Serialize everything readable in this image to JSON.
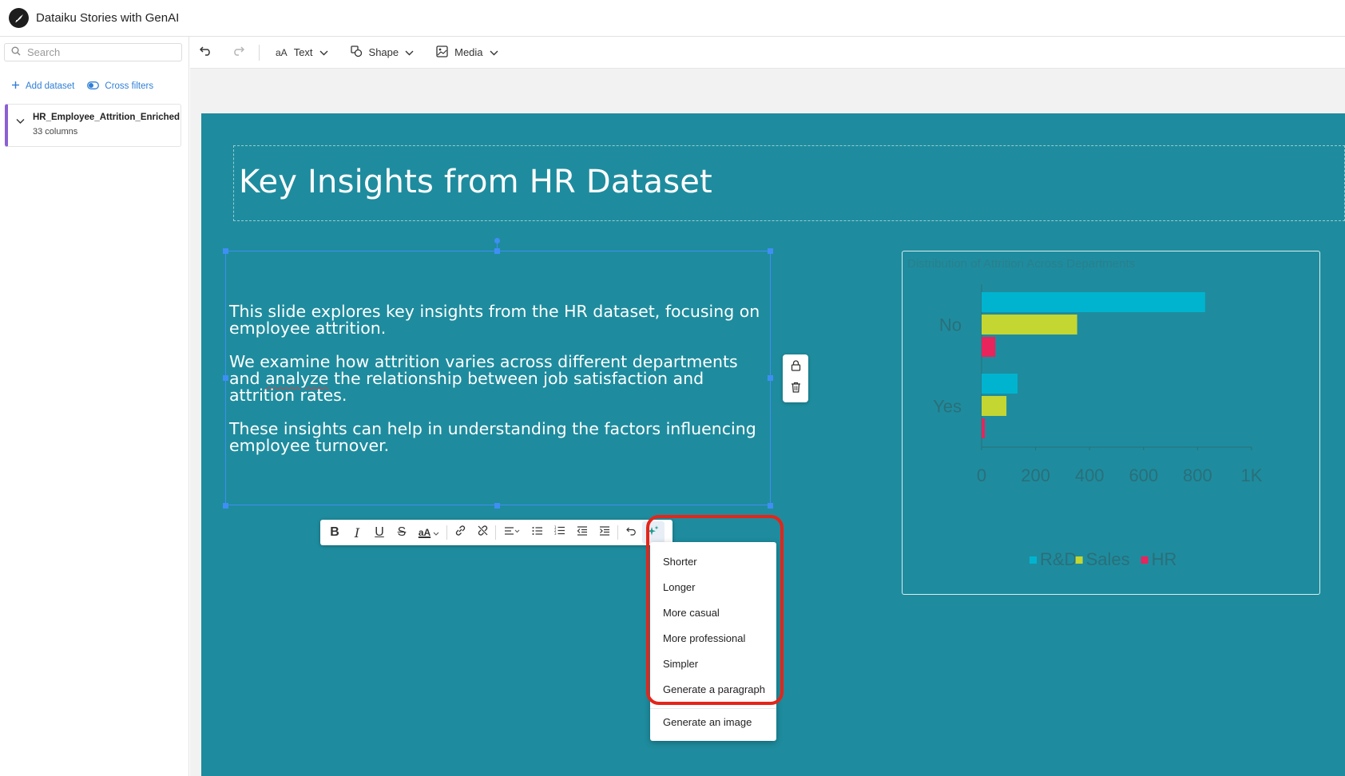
{
  "app": {
    "title": "Dataiku Stories with GenAI"
  },
  "sidebar": {
    "search_placeholder": "Search",
    "add_dataset": "Add dataset",
    "cross_filters": "Cross filters",
    "dataset": {
      "name": "HR_Employee_Attrition_Enriched",
      "columns": "33 columns",
      "accent": "#8c5fd4"
    }
  },
  "toolbar": {
    "undo_icon": "undo-icon",
    "redo_icon": "redo-icon",
    "text_glyph": "aA",
    "text_label": "Text",
    "shape_label": "Shape",
    "media_label": "Media"
  },
  "slide": {
    "background": "#1e8c9e",
    "title": "Key Insights from HR Dataset",
    "paragraphs": {
      "p1": "This slide explores key insights from the HR dataset, focusing on employee attrition.",
      "p2_a": "We examine how attrition varies across different departments and ",
      "p2_b": "analyze",
      "p2_c": " the relationship between job satisfaction and attrition rates.",
      "p3": "These insights can help in understanding the factors influencing employee turnover."
    }
  },
  "format_toolbar": {
    "bold": "B",
    "italic": "I",
    "underline": "U",
    "strike": "S",
    "fontsize": "aA"
  },
  "ai_menu": {
    "items": [
      "Shorter",
      "Longer",
      "More casual",
      "More professional",
      "Simpler",
      "Generate a paragraph"
    ],
    "generate_image": "Generate an image",
    "highlight_color": "#e42519"
  },
  "chart_data": {
    "type": "bar",
    "orientation": "horizontal",
    "title": "Distribution of Attrition Across Departments",
    "categories": [
      "No",
      "Yes"
    ],
    "series": [
      {
        "name": "R&D",
        "color": "#00b4cf",
        "values": [
          828,
          133
        ]
      },
      {
        "name": "Sales",
        "color": "#c4d631",
        "values": [
          354,
          92
        ]
      },
      {
        "name": "HR",
        "color": "#e8245c",
        "values": [
          51,
          12
        ]
      }
    ],
    "xlim": [
      0,
      1000
    ],
    "ticks": [
      "0",
      "200",
      "400",
      "600",
      "800",
      "1K"
    ],
    "legend": "bottom",
    "grid": false
  }
}
